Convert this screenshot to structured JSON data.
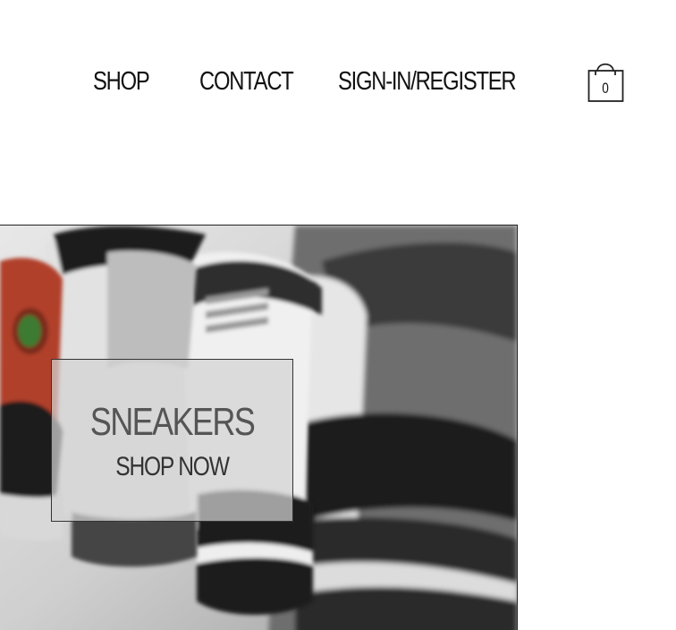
{
  "nav": {
    "shop_label": "SHOP",
    "contact_label": "CONTACT",
    "signin_label": "SIGN-IN/REGISTER"
  },
  "cart": {
    "icon": "shopping-bag-icon",
    "count": "0"
  },
  "hero": {
    "image": "sneakers-row-photo",
    "promo_title": "SNEAKERS",
    "promo_subtitle": "SHOP NOW"
  },
  "colors": {
    "text": "#111111",
    "promo_title": "#555555",
    "promo_subtitle": "#333333",
    "accent_red": "#b0402a"
  }
}
